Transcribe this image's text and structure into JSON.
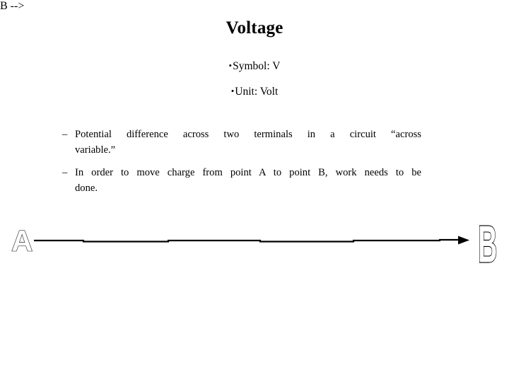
{
  "slide": {
    "title": "Voltage",
    "background_color": "#ffffff",
    "text_color": "#000000"
  },
  "bullets": [
    {
      "mark": "•",
      "label": "Symbol: V"
    },
    {
      "mark": "•",
      "label": "Unit: Volt"
    }
  ],
  "paragraphs": [
    {
      "mark": "–",
      "line1": "Potential difference across two terminals in a circuit “across",
      "line2": "variable.”"
    },
    {
      "mark": "–",
      "line1": "In order to move charge from point A to point B, work needs to be",
      "line2": "done."
    }
  ],
  "diagram": {
    "point_a_label": "A",
    "point_b_label": "B",
    "arrow_color": "#000000",
    "letter_outline_color": "#000000",
    "letter_fill_color": "#ffffff"
  }
}
